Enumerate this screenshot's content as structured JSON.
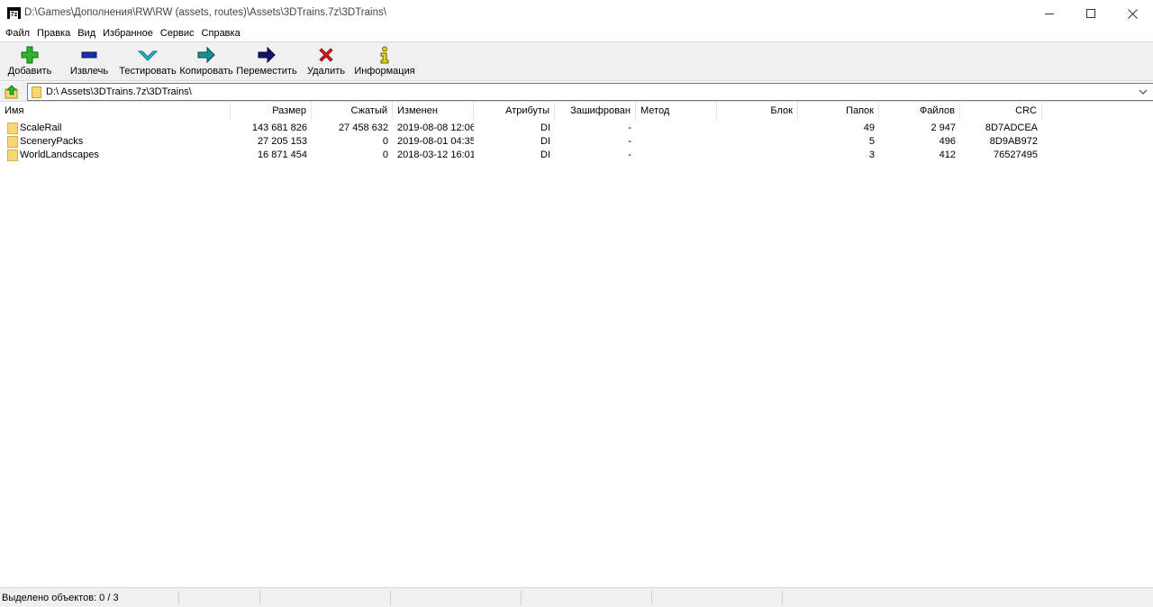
{
  "window": {
    "title": "D:\\Games\\Дополнения\\RW\\RW (assets, routes)\\Assets\\3DTrains.7z\\3DTrains\\",
    "app_icon_text": "7z"
  },
  "menu": [
    "Файл",
    "Правка",
    "Вид",
    "Избранное",
    "Сервис",
    "Справка"
  ],
  "toolbar": [
    {
      "label": "Добавить",
      "icon": "plus-icon"
    },
    {
      "label": "Извлечь",
      "icon": "minus-icon"
    },
    {
      "label": "Тестировать",
      "icon": "check-chevron-icon"
    },
    {
      "label": "Копировать",
      "icon": "copy-arrow-icon"
    },
    {
      "label": "Переместить",
      "icon": "move-arrow-icon"
    },
    {
      "label": "Удалить",
      "icon": "delete-x-icon"
    },
    {
      "label": "Информация",
      "icon": "info-icon"
    }
  ],
  "address": {
    "path": "D:\\ Assets\\3DTrains.7z\\3DTrains\\"
  },
  "columns": [
    "Имя",
    "Размер",
    "Сжатый",
    "Изменен",
    "Атрибуты",
    "Зашифрован",
    "Метод",
    "Блок",
    "Папок",
    "Файлов",
    "CRC"
  ],
  "rows": [
    {
      "name": "ScaleRail",
      "size": "143 681 826",
      "packed": "27 458 632",
      "modified": "2019-08-08 12:06",
      "attributes": "DI",
      "encrypted": "-",
      "method": "",
      "block": "",
      "folders": "49",
      "files": "2 947",
      "crc": "8D7ADCEA"
    },
    {
      "name": "SceneryPacks",
      "size": "27 205 153",
      "packed": "0",
      "modified": "2019-08-01 04:35",
      "attributes": "DI",
      "encrypted": "-",
      "method": "",
      "block": "",
      "folders": "5",
      "files": "496",
      "crc": "8D9AB972"
    },
    {
      "name": "WorldLandscapes",
      "size": "16 871 454",
      "packed": "0",
      "modified": "2018-03-12 16:01",
      "attributes": "DI",
      "encrypted": "-",
      "method": "",
      "block": "",
      "folders": "3",
      "files": "412",
      "crc": "76527495"
    }
  ],
  "status": {
    "selected": "Выделено объектов: 0 / 3"
  },
  "colors": {
    "folder": "#f7d774",
    "plus": "#2db52d",
    "minus": "#1a2fa8",
    "check": "#2ab7c8",
    "copy": "#1a8f8f",
    "move": "#14146e",
    "delete": "#d61a1a",
    "info": "#e6d21a"
  }
}
